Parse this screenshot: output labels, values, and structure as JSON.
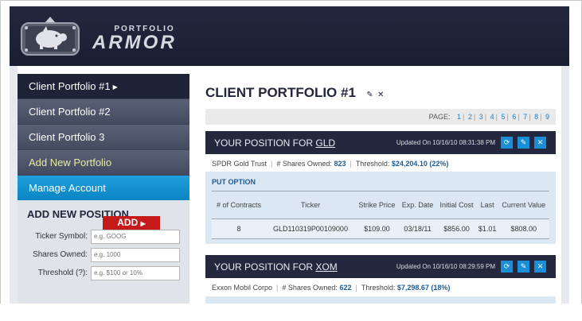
{
  "logo": {
    "line1": "PORTFOLIO",
    "line2": "ARMOR"
  },
  "sidebar": {
    "items": [
      {
        "label": "Client Portfolio #1",
        "has_caret": true
      },
      {
        "label": "Client Portfolio #2"
      },
      {
        "label": "Client Portfolio 3"
      },
      {
        "label": "Add New Portfolio"
      },
      {
        "label": "Manage Account"
      }
    ]
  },
  "add_position": {
    "title": "ADD NEW POSITION",
    "fields": [
      {
        "label": "Ticker Symbol:",
        "placeholder": "e.g. GOOG"
      },
      {
        "label": "Shares Owned:",
        "placeholder": "e.g. 1000"
      },
      {
        "label": "Threshold (?):",
        "placeholder": "e.g. $100 or 10%"
      }
    ],
    "button": "ADD"
  },
  "main": {
    "title": "CLIENT PORTFOLIO #1",
    "edit_icon": "✎",
    "close_icon": "✕",
    "pager": {
      "label": "PAGE:",
      "pages": [
        "1",
        "2",
        "3",
        "4",
        "5",
        "6",
        "7",
        "8",
        "9"
      ]
    }
  },
  "positions": [
    {
      "prefix": "YOUR POSITION FOR",
      "ticker": "GLD",
      "updated": "Updated On 10/16/10 08:31:38 PM",
      "name": "SPDR Gold Trust",
      "shares_label": "# Shares Owned:",
      "shares": "823",
      "threshold_label": "Threshold:",
      "threshold": "$24,204.10 (22%)",
      "option_label": "PUT OPTION",
      "columns": [
        "# of Contracts",
        "Ticker",
        "Strike Price",
        "Exp. Date",
        "Initial Cost",
        "Last",
        "Current Value"
      ],
      "rows": [
        [
          "8",
          "GLD110319P00109000",
          "$109.00",
          "03/18/11",
          "$856.00",
          "$1.01",
          "$808.00"
        ]
      ]
    },
    {
      "prefix": "YOUR POSITION FOR",
      "ticker": "XOM",
      "updated": "Updated On 10/16/10 08:29:59 PM",
      "name": "Exxon Mobil Corpo",
      "shares_label": "# Shares Owned:",
      "shares": "622",
      "threshold_label": "Threshold:",
      "threshold": "$7,298.67 (18%)"
    }
  ],
  "colors": {
    "header_navy": "#23283f",
    "accent_blue": "#1a8fd6",
    "add_red": "#c41a1a",
    "manage_blue": "#1ea0dc"
  }
}
